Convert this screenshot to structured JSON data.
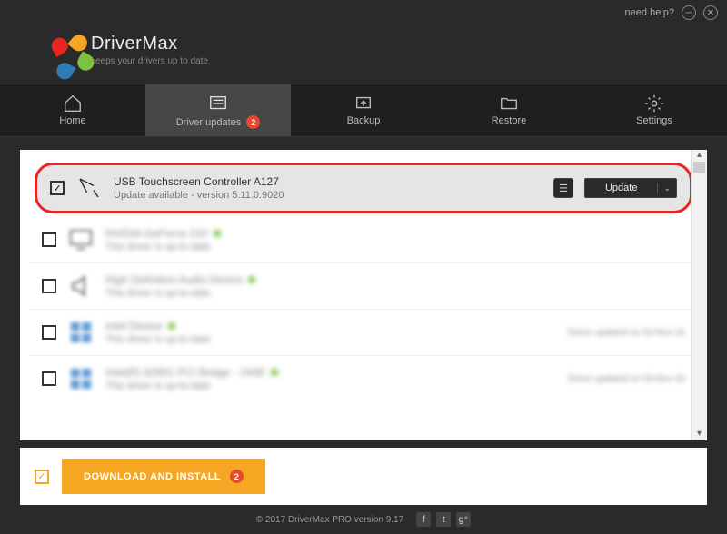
{
  "titlebar": {
    "help": "need help?"
  },
  "brand": {
    "name": "DriverMax",
    "tag": "keeps your drivers up to date"
  },
  "tabs": {
    "home": "Home",
    "updates": "Driver updates",
    "updates_badge": "2",
    "backup": "Backup",
    "restore": "Restore",
    "settings": "Settings"
  },
  "rows": {
    "r1": {
      "title": "USB Touchscreen Controller A127",
      "sub": "Update available - version 5.11.0.9020"
    },
    "r2": {
      "title": "NVIDIA GeForce 210",
      "sub": "This driver is up-to-date"
    },
    "r3": {
      "title": "High Definition Audio Device",
      "sub": "This driver is up-to-date"
    },
    "r4": {
      "title": "Intel Device",
      "sub": "This driver is up-to-date",
      "note": "Driver updated on 03-Nov-16"
    },
    "r5": {
      "title": "Intel(R) 82801 PCI Bridge - 244E",
      "sub": "This driver is up-to-date",
      "note": "Driver updated on 03-Nov-16"
    }
  },
  "buttons": {
    "update": "Update",
    "download": "DOWNLOAD AND INSTALL",
    "download_badge": "2"
  },
  "footer": {
    "copy": "© 2017 DriverMax PRO version 9.17"
  }
}
